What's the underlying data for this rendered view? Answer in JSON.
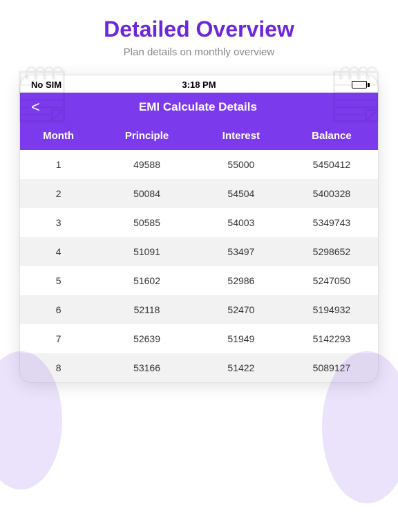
{
  "outer": {
    "title": "Detailed Overview",
    "subtitle": "Plan details on monthly overview"
  },
  "status_bar": {
    "carrier": "No SIM",
    "time": "3:18 PM"
  },
  "navbar": {
    "title": "EMI Calculate Details",
    "back_label": "<"
  },
  "table": {
    "headers": [
      "Month",
      "Principle",
      "Interest",
      "Balance"
    ],
    "rows": [
      {
        "month": "1",
        "principle": "49588",
        "interest": "55000",
        "balance": "5450412"
      },
      {
        "month": "2",
        "principle": "50084",
        "interest": "54504",
        "balance": "5400328"
      },
      {
        "month": "3",
        "principle": "50585",
        "interest": "54003",
        "balance": "5349743"
      },
      {
        "month": "4",
        "principle": "51091",
        "interest": "53497",
        "balance": "5298652"
      },
      {
        "month": "5",
        "principle": "51602",
        "interest": "52986",
        "balance": "5247050"
      },
      {
        "month": "6",
        "principle": "52118",
        "interest": "52470",
        "balance": "5194932"
      },
      {
        "month": "7",
        "principle": "52639",
        "interest": "51949",
        "balance": "5142293"
      },
      {
        "month": "8",
        "principle": "53166",
        "interest": "51422",
        "balance": "5089127"
      }
    ]
  },
  "colors": {
    "purple": "#7c3aed",
    "white": "#ffffff"
  }
}
